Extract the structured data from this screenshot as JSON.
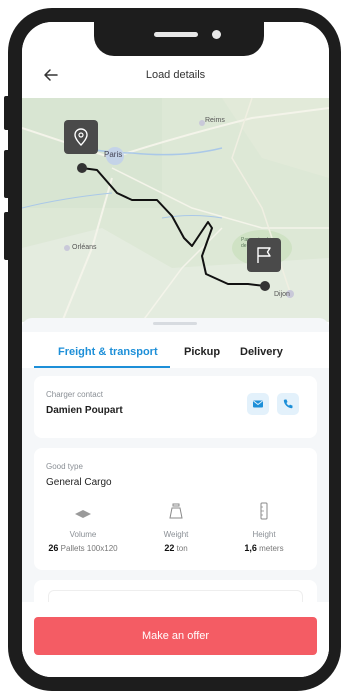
{
  "header": {
    "title": "Load details",
    "back_icon": "arrow-left-icon"
  },
  "map": {
    "labels": {
      "reims": "Reims",
      "paris": "Paris",
      "orleans": "Orléans",
      "dijon": "Dijon",
      "park": "Parc naturel\nde fo"
    },
    "origin_marker_icon": "location-pin-icon",
    "destination_marker_icon": "flag-icon"
  },
  "tabs": [
    {
      "label": "Freight & transport",
      "active": true
    },
    {
      "label": "Pickup",
      "active": false
    },
    {
      "label": "Delivery",
      "active": false
    }
  ],
  "contact": {
    "label": "Charger contact",
    "name": "Damien Poupart",
    "email_icon": "email-icon",
    "phone_icon": "phone-icon"
  },
  "good": {
    "label": "Good type",
    "value": "General Cargo",
    "metrics": [
      {
        "icon": "pallet-icon",
        "label": "Volume",
        "value": "26",
        "unit": "Pallets 100x120"
      },
      {
        "icon": "weight-icon",
        "label": "Weight",
        "value": "22",
        "unit": "ton"
      },
      {
        "icon": "height-icon",
        "label": "Height",
        "value": "1,6",
        "unit": "meters"
      }
    ]
  },
  "vehicle": {
    "icon": "truck-icon"
  },
  "cta": {
    "label": "Make an offer"
  },
  "colors": {
    "accent": "#1d8fd8",
    "cta": "#f45c64",
    "route": "#111111",
    "marker": "#4a4a4a"
  }
}
